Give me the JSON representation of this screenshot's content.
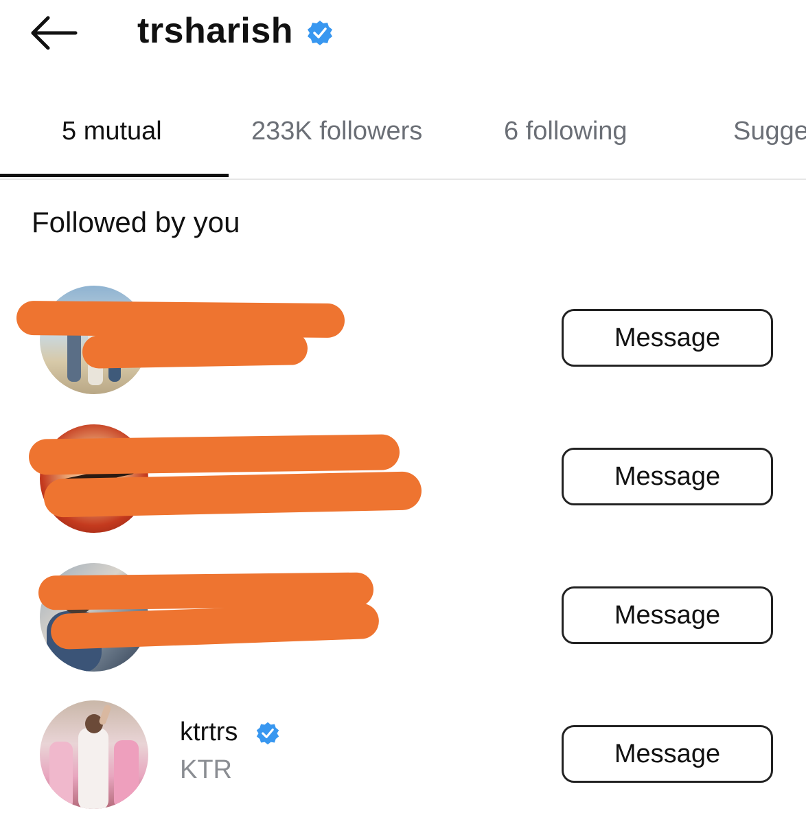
{
  "header": {
    "title": "trsharish",
    "back_icon": "arrow-left-icon",
    "verified_icon": "verified-badge-icon",
    "verified_color": "#3897f0"
  },
  "tabs": [
    {
      "label": "5 mutual",
      "active": true
    },
    {
      "label": "233K followers",
      "active": false
    },
    {
      "label": "6 following",
      "active": false
    },
    {
      "label": "Sugge",
      "active": false
    }
  ],
  "section": {
    "title": "Followed by you"
  },
  "rows": [
    {
      "username": "",
      "display_name": "",
      "redacted": true,
      "button_label": "Message"
    },
    {
      "username": "",
      "display_name": "",
      "redacted": true,
      "button_label": "Message"
    },
    {
      "username": "",
      "display_name": "",
      "redacted": true,
      "button_label": "Message"
    },
    {
      "username": "ktrtrs",
      "display_name": "KTR",
      "redacted": false,
      "verified": true,
      "button_label": "Message"
    }
  ],
  "colors": {
    "redaction": "#ee7430",
    "active_tab_indicator": "#111111",
    "inactive_tab_text": "#6b6f76"
  }
}
